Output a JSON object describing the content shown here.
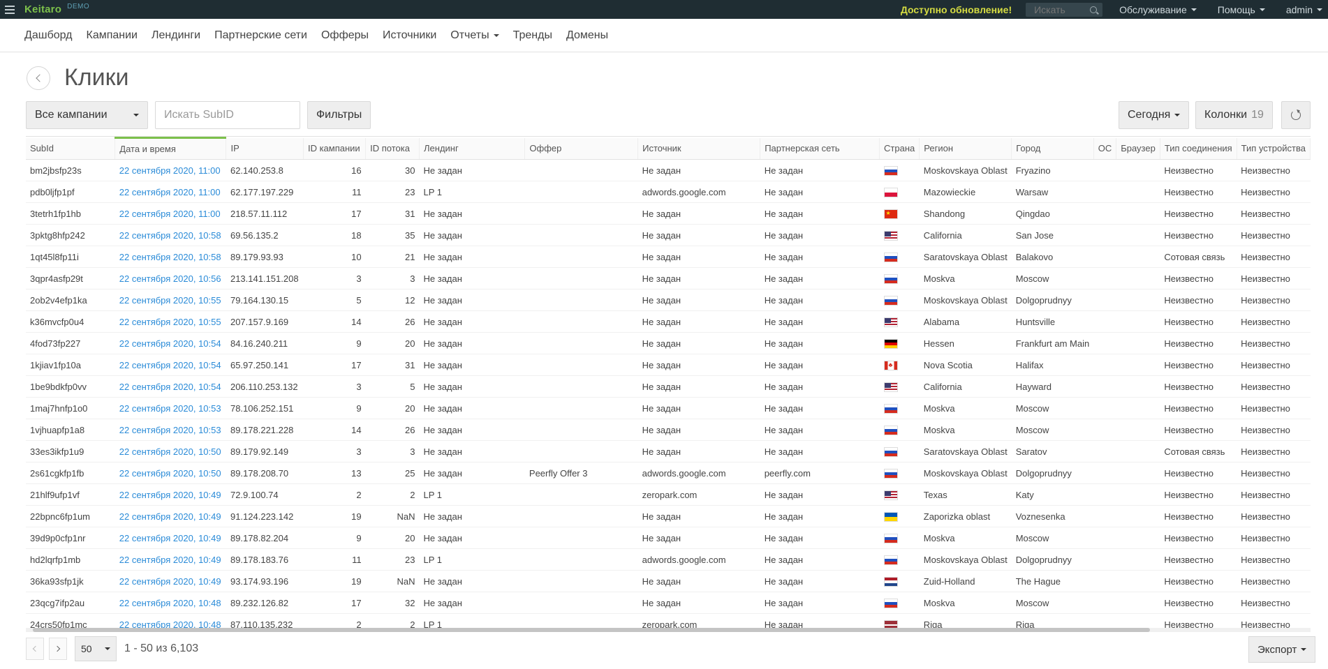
{
  "topbar": {
    "logo": "Keitaro",
    "logo_tag": "DEMO",
    "update_notice": "Доступно обновление!",
    "search_placeholder": "Искать",
    "menu_service": "Обслуживание",
    "menu_help": "Помощь",
    "menu_user": "admin"
  },
  "nav": {
    "items": [
      "Дашборд",
      "Кампании",
      "Лендинги",
      "Партнерские сети",
      "Офферы",
      "Источники",
      "Отчеты",
      "Тренды",
      "Домены"
    ]
  },
  "page": {
    "title": "Клики"
  },
  "toolbar": {
    "campaign_select": "Все кампании",
    "subid_placeholder": "Искать SubID",
    "filters_label": "Фильтры",
    "period_label": "Сегодня",
    "columns_label": "Колонки",
    "columns_count": "19"
  },
  "table": {
    "headers": [
      "SubId",
      "Дата и время",
      "IP",
      "ID кампании",
      "ID потока",
      "Лендинг",
      "Оффер",
      "Источник",
      "Партнерская сеть",
      "Страна",
      "Регион",
      "Город",
      "ОС",
      "Браузер",
      "Тип соединения",
      "Тип устройства"
    ],
    "rows": [
      [
        "bm2jbsfp23s",
        "22 сентября 2020, 11:00",
        "62.140.253.8",
        "16",
        "30",
        "Не задан",
        "",
        "Не задан",
        "Не задан",
        "ru",
        "Moskovskaya Oblast",
        "Fryazino",
        "",
        "",
        "Неизвестно",
        "Неизвестно"
      ],
      [
        "pdb0ljfp1pf",
        "22 сентября 2020, 11:00",
        "62.177.197.229",
        "11",
        "23",
        "LP 1",
        "",
        "adwords.google.com",
        "Не задан",
        "pl",
        "Mazowieckie",
        "Warsaw",
        "",
        "",
        "Неизвестно",
        "Неизвестно"
      ],
      [
        "3tetrh1fp1hb",
        "22 сентября 2020, 11:00",
        "218.57.11.112",
        "17",
        "31",
        "Не задан",
        "",
        "Не задан",
        "Не задан",
        "cn",
        "Shandong",
        "Qingdao",
        "",
        "",
        "Неизвестно",
        "Неизвестно"
      ],
      [
        "3pktg8hfp242",
        "22 сентября 2020, 10:58",
        "69.56.135.2",
        "18",
        "35",
        "Не задан",
        "",
        "Не задан",
        "Не задан",
        "us",
        "California",
        "San Jose",
        "",
        "",
        "Неизвестно",
        "Неизвестно"
      ],
      [
        "1qt45l8fp11i",
        "22 сентября 2020, 10:58",
        "89.179.93.93",
        "10",
        "21",
        "Не задан",
        "",
        "Не задан",
        "Не задан",
        "ru",
        "Saratovskaya Oblast",
        "Balakovo",
        "",
        "",
        "Сотовая связь",
        "Неизвестно"
      ],
      [
        "3qpr4asfp29t",
        "22 сентября 2020, 10:56",
        "213.141.151.208",
        "3",
        "3",
        "Не задан",
        "",
        "Не задан",
        "Не задан",
        "ru",
        "Moskva",
        "Moscow",
        "",
        "",
        "Неизвестно",
        "Неизвестно"
      ],
      [
        "2ob2v4efp1ka",
        "22 сентября 2020, 10:55",
        "79.164.130.15",
        "5",
        "12",
        "Не задан",
        "",
        "Не задан",
        "Не задан",
        "ru",
        "Moskovskaya Oblast",
        "Dolgoprudnyy",
        "",
        "",
        "Неизвестно",
        "Неизвестно"
      ],
      [
        "k36mvcfp0u4",
        "22 сентября 2020, 10:55",
        "207.157.9.169",
        "14",
        "26",
        "Не задан",
        "",
        "Не задан",
        "Не задан",
        "us",
        "Alabama",
        "Huntsville",
        "",
        "",
        "Неизвестно",
        "Неизвестно"
      ],
      [
        "4fod73fp227",
        "22 сентября 2020, 10:54",
        "84.16.240.211",
        "9",
        "20",
        "Не задан",
        "",
        "Не задан",
        "Не задан",
        "de",
        "Hessen",
        "Frankfurt am Main",
        "",
        "",
        "Неизвестно",
        "Неизвестно"
      ],
      [
        "1kjiav1fp10a",
        "22 сентября 2020, 10:54",
        "65.97.250.141",
        "17",
        "31",
        "Не задан",
        "",
        "Не задан",
        "Не задан",
        "ca",
        "Nova Scotia",
        "Halifax",
        "",
        "",
        "Неизвестно",
        "Неизвестно"
      ],
      [
        "1be9bdkfp0vv",
        "22 сентября 2020, 10:54",
        "206.110.253.132",
        "3",
        "5",
        "Не задан",
        "",
        "Не задан",
        "Не задан",
        "us",
        "California",
        "Hayward",
        "",
        "",
        "Неизвестно",
        "Неизвестно"
      ],
      [
        "1maj7hnfp1o0",
        "22 сентября 2020, 10:53",
        "78.106.252.151",
        "9",
        "20",
        "Не задан",
        "",
        "Не задан",
        "Не задан",
        "ru",
        "Moskva",
        "Moscow",
        "",
        "",
        "Неизвестно",
        "Неизвестно"
      ],
      [
        "1vjhuapfp1a8",
        "22 сентября 2020, 10:53",
        "89.178.221.228",
        "14",
        "26",
        "Не задан",
        "",
        "Не задан",
        "Не задан",
        "ru",
        "Moskva",
        "Moscow",
        "",
        "",
        "Неизвестно",
        "Неизвестно"
      ],
      [
        "33es3ikfp1u9",
        "22 сентября 2020, 10:50",
        "89.179.92.149",
        "3",
        "3",
        "Не задан",
        "",
        "Не задан",
        "Не задан",
        "ru",
        "Saratovskaya Oblast",
        "Saratov",
        "",
        "",
        "Сотовая связь",
        "Неизвестно"
      ],
      [
        "2s61cgkfp1fb",
        "22 сентября 2020, 10:50",
        "89.178.208.70",
        "13",
        "25",
        "Не задан",
        "Peerfly Offer 3",
        "adwords.google.com",
        "peerfly.com",
        "ru",
        "Moskovskaya Oblast",
        "Dolgoprudnyy",
        "",
        "",
        "Неизвестно",
        "Неизвестно"
      ],
      [
        "21hlf9ufp1vf",
        "22 сентября 2020, 10:49",
        "72.9.100.74",
        "2",
        "2",
        "LP 1",
        "",
        "zeropark.com",
        "Не задан",
        "us",
        "Texas",
        "Katy",
        "",
        "",
        "Неизвестно",
        "Неизвестно"
      ],
      [
        "22bpnc6fp1um",
        "22 сентября 2020, 10:49",
        "91.124.223.142",
        "19",
        "NaN",
        "Не задан",
        "",
        "Не задан",
        "Не задан",
        "ua",
        "Zaporizka oblast",
        "Voznesenka",
        "",
        "",
        "Неизвестно",
        "Неизвестно"
      ],
      [
        "39d9p0cfp1nr",
        "22 сентября 2020, 10:49",
        "89.178.82.204",
        "9",
        "20",
        "Не задан",
        "",
        "Не задан",
        "Не задан",
        "ru",
        "Moskva",
        "Moscow",
        "",
        "",
        "Неизвестно",
        "Неизвестно"
      ],
      [
        "hd2lqrfp1mb",
        "22 сентября 2020, 10:49",
        "89.178.183.76",
        "11",
        "23",
        "LP 1",
        "",
        "adwords.google.com",
        "Не задан",
        "ru",
        "Moskovskaya Oblast",
        "Dolgoprudnyy",
        "",
        "",
        "Неизвестно",
        "Неизвестно"
      ],
      [
        "36ka93sfp1jk",
        "22 сентября 2020, 10:49",
        "93.174.93.196",
        "19",
        "NaN",
        "Не задан",
        "",
        "Не задан",
        "Не задан",
        "nl",
        "Zuid-Holland",
        "The Hague",
        "",
        "",
        "Неизвестно",
        "Неизвестно"
      ],
      [
        "23qcg7ifp2au",
        "22 сентября 2020, 10:48",
        "89.232.126.82",
        "17",
        "32",
        "Не задан",
        "",
        "Не задан",
        "Не задан",
        "ru",
        "Moskva",
        "Moscow",
        "",
        "",
        "Неизвестно",
        "Неизвестно"
      ],
      [
        "24crs50fp1mc",
        "22 сентября 2020, 10:48",
        "87.110.135.232",
        "2",
        "2",
        "LP 1",
        "",
        "zeropark.com",
        "Не задан",
        "lv",
        "Riga",
        "Riga",
        "",
        "",
        "Неизвестно",
        "Неизвестно"
      ]
    ]
  },
  "pagination": {
    "per_page": "50",
    "info": "1 - 50 из 6,103",
    "export_label": "Экспорт"
  }
}
